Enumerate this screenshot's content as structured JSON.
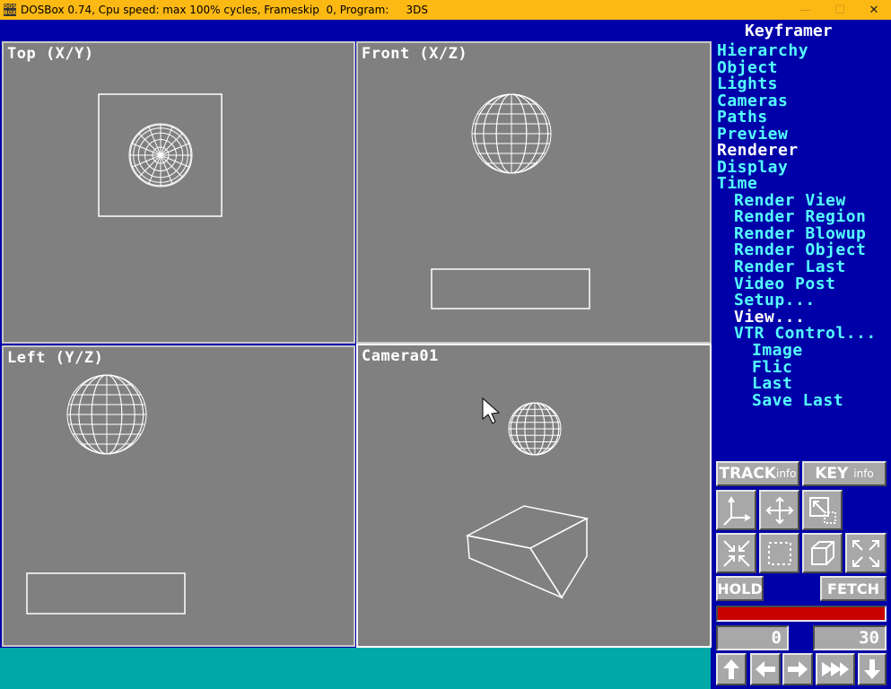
{
  "window": {
    "title": "DOSBox 0.74, Cpu speed: max 100% cycles, Frameskip  0, Program:     3DS",
    "icon_text": "DOS BOX",
    "minimize": "—",
    "maximize": "☐",
    "close": "✕"
  },
  "viewports": {
    "top": "Top (X/Y)",
    "front": "Front (X/Z)",
    "left": "Left (Y/Z)",
    "camera": "Camera01"
  },
  "menu": {
    "header": "Keyframer",
    "main": [
      "Hierarchy",
      "Object",
      "Lights",
      "Cameras",
      "Paths",
      "Preview",
      "Renderer",
      "Display",
      "Time"
    ],
    "active_main": "Renderer",
    "sub": [
      "Render View",
      "Render Region",
      "Render Blowup",
      "Render Object",
      "Render Last",
      "Video Post",
      "Setup...",
      "View...",
      "VTR Control..."
    ],
    "active_sub": "View...",
    "subsub": [
      "Image",
      "Flic",
      "Last",
      "Save Last"
    ]
  },
  "tools": {
    "track_main": "TRACK",
    "track_small": "info",
    "key_main": "KEY",
    "key_small": "info",
    "hold": "HOLD",
    "fetch": "FETCH",
    "frame_current": "0",
    "frame_total": "30",
    "icons": [
      "axis-icon",
      "move-icon",
      "region-zoom-icon",
      "zoom-in-icon",
      "zoom-out-icon",
      "box-select-icon",
      "cube-view-icon",
      "zoom-extents-icon"
    ],
    "nav": [
      "up-arrow-icon",
      "left-arrow-icon",
      "right-arrow-icon",
      "fast-forward-icon",
      "down-arrow-icon"
    ]
  },
  "colors": {
    "title_bar": "#fdb913",
    "background": "#0000a8",
    "viewport": "#808080",
    "menu_text": "#55ffff",
    "menu_active": "#ffffff",
    "status_bar": "#00a8a8",
    "progress": "#c80000"
  }
}
